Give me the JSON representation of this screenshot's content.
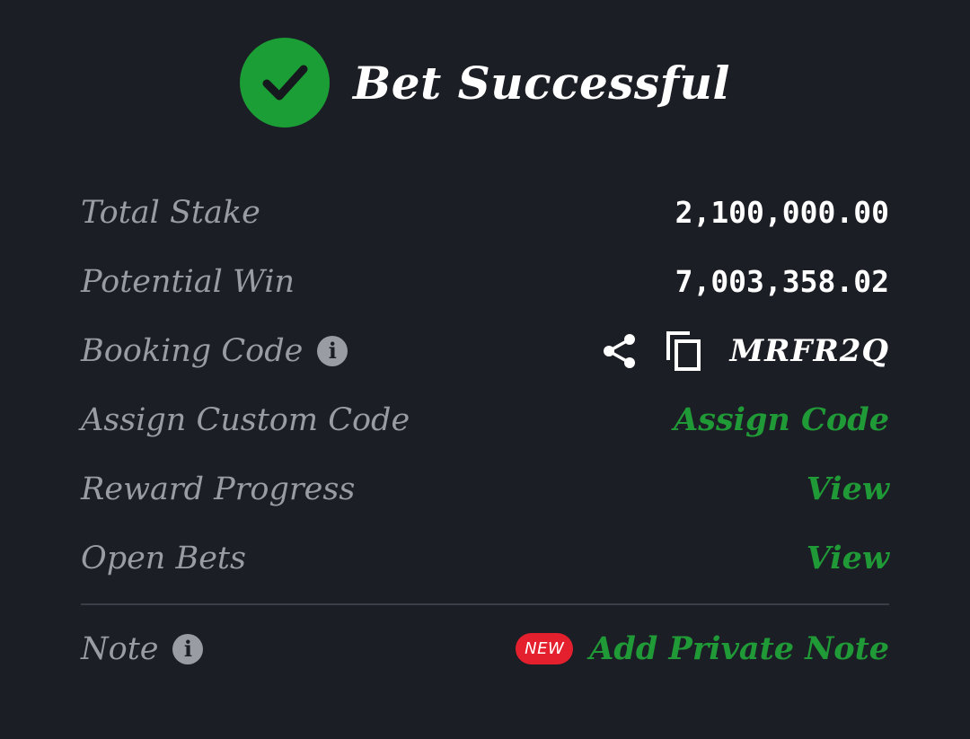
{
  "header": {
    "title": "Bet Successful",
    "icon": "check-circle-icon",
    "accent_color": "#1b9e35"
  },
  "rows": {
    "total_stake": {
      "label": "Total Stake",
      "value": "2,100,000.00"
    },
    "potential_win": {
      "label": "Potential Win",
      "value": "7,003,358.02"
    },
    "booking_code": {
      "label": "Booking Code",
      "value": "MRFR2Q",
      "info_icon": "info-icon",
      "share_icon": "share-icon",
      "copy_icon": "copy-icon"
    },
    "assign_custom_code": {
      "label": "Assign Custom Code",
      "action": "Assign Code"
    },
    "reward_progress": {
      "label": "Reward Progress",
      "action": "View"
    },
    "open_bets": {
      "label": "Open Bets",
      "action": "View"
    },
    "note": {
      "label": "Note",
      "badge": "NEW",
      "action": "Add Private Note"
    }
  },
  "colors": {
    "background": "#1c1e25",
    "label": "#9a9ca3",
    "link": "#1f9a37",
    "badge": "#e5202e"
  }
}
